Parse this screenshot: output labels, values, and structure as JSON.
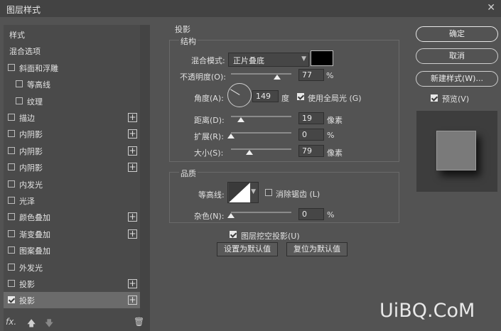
{
  "window": {
    "title": "图层样式",
    "close_glyph": "✕"
  },
  "left_panel": {
    "items": [
      {
        "label": "样式",
        "checkbox": false,
        "checked": false,
        "plus": false,
        "indent": 0
      },
      {
        "label": "混合选项",
        "checkbox": false,
        "checked": false,
        "plus": false,
        "indent": 0
      },
      {
        "label": "斜面和浮雕",
        "checkbox": true,
        "checked": false,
        "plus": false,
        "indent": 0
      },
      {
        "label": "等高线",
        "checkbox": true,
        "checked": false,
        "plus": false,
        "indent": 1
      },
      {
        "label": "纹理",
        "checkbox": true,
        "checked": false,
        "plus": false,
        "indent": 1
      },
      {
        "label": "描边",
        "checkbox": true,
        "checked": false,
        "plus": true,
        "indent": 0
      },
      {
        "label": "内阴影",
        "checkbox": true,
        "checked": false,
        "plus": true,
        "indent": 0
      },
      {
        "label": "内阴影",
        "checkbox": true,
        "checked": false,
        "plus": true,
        "indent": 0
      },
      {
        "label": "内阴影",
        "checkbox": true,
        "checked": false,
        "plus": true,
        "indent": 0
      },
      {
        "label": "内发光",
        "checkbox": true,
        "checked": false,
        "plus": false,
        "indent": 0
      },
      {
        "label": "光泽",
        "checkbox": true,
        "checked": false,
        "plus": false,
        "indent": 0
      },
      {
        "label": "颜色叠加",
        "checkbox": true,
        "checked": false,
        "plus": true,
        "indent": 0
      },
      {
        "label": "渐变叠加",
        "checkbox": true,
        "checked": false,
        "plus": true,
        "indent": 0
      },
      {
        "label": "图案叠加",
        "checkbox": true,
        "checked": false,
        "plus": false,
        "indent": 0
      },
      {
        "label": "外发光",
        "checkbox": true,
        "checked": false,
        "plus": false,
        "indent": 0
      },
      {
        "label": "投影",
        "checkbox": true,
        "checked": false,
        "plus": true,
        "indent": 0
      },
      {
        "label": "投影",
        "checkbox": true,
        "checked": true,
        "plus": true,
        "indent": 0,
        "selected": true
      }
    ],
    "fx_label": "fx.",
    "up_glyph": "🡅",
    "down_glyph": "🡇",
    "trash_glyph": "🗑"
  },
  "drop_shadow": {
    "section_title": "投影",
    "structure": {
      "title": "结构",
      "blend_mode_label": "混合模式:",
      "blend_mode_value": "正片叠底",
      "shadow_color": "#000000",
      "opacity_label": "不透明度(O):",
      "opacity_value": "77",
      "opacity_fraction": 0.77,
      "angle_label": "角度(A):",
      "angle_value": "149",
      "angle_unit": "度",
      "global_light_label": "使用全局光 (G)",
      "global_light_checked": true,
      "distance_label": "距离(D):",
      "distance_value": "19",
      "distance_fraction": 0.17,
      "spread_label": "扩展(R):",
      "spread_value": "0",
      "spread_fraction": 0,
      "size_label": "大小(S):",
      "size_value": "79",
      "size_fraction": 0.3,
      "percent": "%",
      "pixels": "像素"
    },
    "quality": {
      "title": "品质",
      "contour_label": "等高线:",
      "antialias_label": "消除锯齿 (L)",
      "antialias_checked": false,
      "noise_label": "杂色(N):",
      "noise_value": "0",
      "noise_fraction": 0
    },
    "knockout_label": "图层挖空投影(U)",
    "knockout_checked": true,
    "make_default": "设置为默认值",
    "reset_default": "复位为默认值"
  },
  "right_panel": {
    "ok": "确定",
    "cancel": "取消",
    "new_style": "新建样式(W)...",
    "preview_label": "预览(V)",
    "preview_checked": true
  },
  "watermark": "UiBQ.CoM"
}
